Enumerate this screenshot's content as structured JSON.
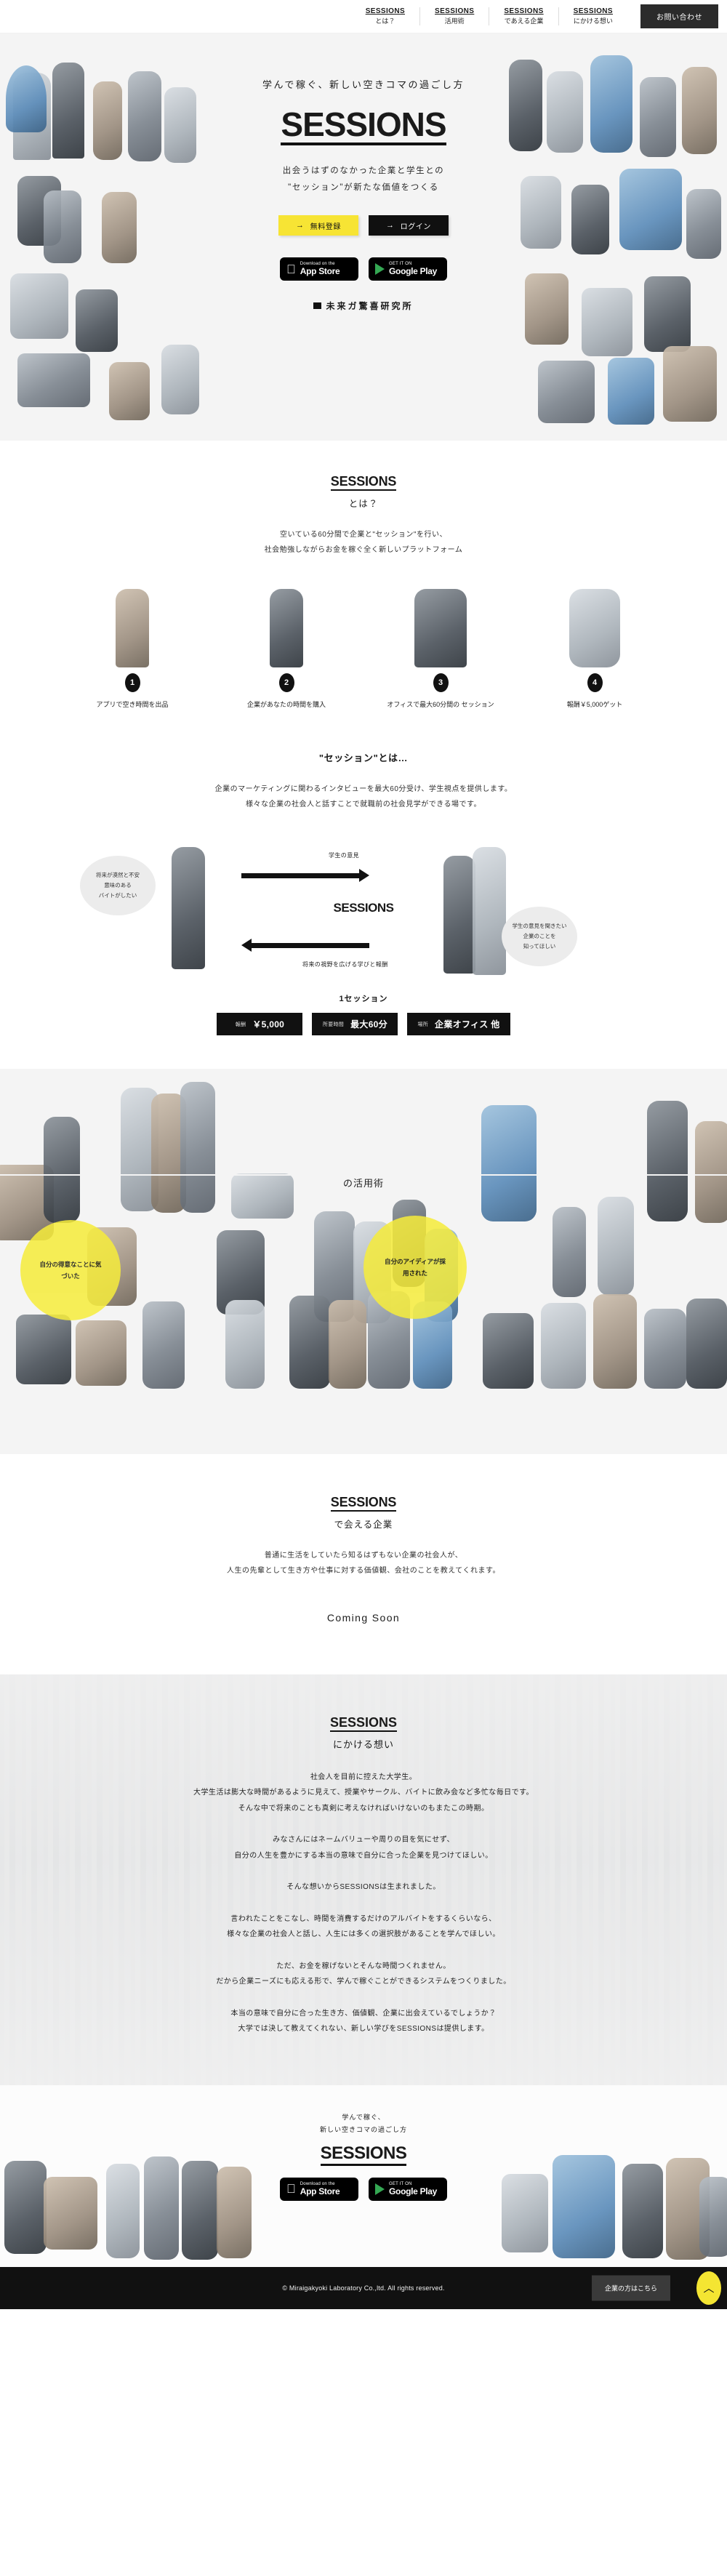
{
  "header": {
    "nav": [
      {
        "logo": "SESSIONS",
        "sub": "とは？",
        "name": "nav-about"
      },
      {
        "logo": "SESSIONS",
        "sub": "活用術",
        "name": "nav-usage"
      },
      {
        "logo": "SESSIONS",
        "sub": "であえる企業",
        "name": "nav-companies"
      },
      {
        "logo": "SESSIONS",
        "sub": "にかける想い",
        "name": "nav-omoi"
      }
    ],
    "contact_label": "お問い合わせ"
  },
  "hero": {
    "tagline": "学んで稼ぐ、新しい空きコマの過ごし方",
    "logo": "SESSIONS",
    "sub_line1": "出会うはずのなかった企業と学生との",
    "sub_line2": "\"セッション\"が新たな価値をつくる",
    "btn_register": "無料登録",
    "btn_login": "ログイン",
    "arrow": "→",
    "appstore_small": "Download on the",
    "appstore_large": "App Store",
    "googleplay_small": "GET IT ON",
    "googleplay_large": "Google Play",
    "brand": "未来ガ驚喜研究所"
  },
  "about": {
    "logo": "SESSIONS",
    "sub": "とは？",
    "body_line1": "空いている60分間で企業と\"セッション\"を行い、",
    "body_line2": "社会勉強しながらお金を稼ぐ全く新しいプラットフォーム",
    "steps": [
      {
        "num": "1",
        "label": "アプリで空き時間を出品"
      },
      {
        "num": "2",
        "label": "企業があなたの時間を購入"
      },
      {
        "num": "3",
        "label": "オフィスで最大60分間の\nセッション"
      },
      {
        "num": "4",
        "label": "報酬￥5,000ゲット"
      }
    ]
  },
  "session": {
    "title": "\"セッション\"とは…",
    "body_line1": "企業のマーケティングに関わるインタビューを最大60分受け、学生視点を提供します。",
    "body_line2": "様々な企業の社会人と話すことで就職前の社会見学ができる場です。",
    "bubble_left": "将来が漠然と不安\n意味のある\nバイトがしたい",
    "bubble_right": "学生の意見を聞きたい\n企業のことを\n知ってほしい",
    "arrow_top_label": "学生の意見",
    "arrow_bottom_label": "将来の視野を広げる学びと報酬",
    "center_logo": "SESSIONS",
    "one_session": "1セッション",
    "chips": [
      {
        "key": "報酬",
        "value": "￥5,000"
      },
      {
        "key": "所要時間",
        "value": "最大60分"
      },
      {
        "key": "場所",
        "value": "企業オフィス 他"
      }
    ]
  },
  "usage": {
    "logo": "SESSIONS",
    "sub": "の活用術",
    "circles": [
      {
        "text": "自分の得意なことに気\nづいた"
      },
      {
        "text": "自分のアイディアが採\n用された"
      }
    ]
  },
  "companies": {
    "logo": "SESSIONS",
    "sub": "で会える企業",
    "body_line1": "普通に生活をしていたら知るはずもない企業の社会人が、",
    "body_line2": "人生の先輩として生き方や仕事に対する価値観、会社のことを教えてくれます。",
    "coming_soon": "Coming Soon"
  },
  "omoi": {
    "logo": "SESSIONS",
    "sub": "にかける想い",
    "paragraphs": [
      "社会人を目前に控えた大学生。\n大学生活は膨大な時間があるように見えて、授業やサークル、バイトに飲み会など多忙な毎日です。\nそんな中で将来のことも真剣に考えなければいけないのもまたこの時期。",
      "みなさんにはネームバリューや周りの目を気にせず、\n自分の人生を豊かにする本当の意味で自分に合った企業を見つけてほしい。",
      "そんな想いからSESSIONSは生まれました。",
      "言われたことをこなし、時間を消費するだけのアルバイトをするくらいなら、\n様々な企業の社会人と話し、人生には多くの選択肢があることを学んでほしい。",
      "ただ、お金を稼げないとそんな時間つくれません。\nだから企業ニーズにも応える形で、学んで稼ぐことができるシステムをつくりました。",
      "本当の意味で自分に合った生き方、価値観、企業に出会えているでしょうか？\n大学では決して教えてくれない、新しい学びをSESSIONSは提供します。"
    ]
  },
  "footer": {
    "tag_line1": "学んで稼ぐ、",
    "tag_line2": "新しい空きコマの過ごし方",
    "logo": "SESSIONS",
    "appstore_small": "Download on the",
    "appstore_large": "App Store",
    "googleplay_small": "GET IT ON",
    "googleplay_large": "Google Play",
    "copyright": "© Miraigakyoki Laboratory Co.,ltd. All rights reserved.",
    "biz_label": "企業の方はこちら",
    "totop_icon": "︿"
  },
  "colors": {
    "accent_yellow": "#f6ec3c",
    "dark": "#111111",
    "hero_bg": "#f4f4f4"
  }
}
